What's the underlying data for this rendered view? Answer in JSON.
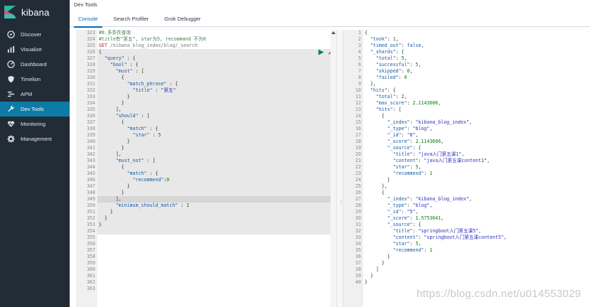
{
  "app": {
    "logo_text": "kibana",
    "title": "Dev Tools"
  },
  "colors": {
    "sidebar_bg": "#222c37",
    "active_nav": "#0e7ba4",
    "tab_accent": "#006bb4"
  },
  "sidebar": {
    "items": [
      {
        "label": "Discover",
        "icon": "compass-icon"
      },
      {
        "label": "Visualize",
        "icon": "bar-chart-icon"
      },
      {
        "label": "Dashboard",
        "icon": "dashboard-icon"
      },
      {
        "label": "Timelion",
        "icon": "shield-icon"
      },
      {
        "label": "APM",
        "icon": "apm-icon"
      },
      {
        "label": "Dev Tools",
        "icon": "wrench-icon",
        "active": true
      },
      {
        "label": "Monitoring",
        "icon": "heartbeat-icon"
      },
      {
        "label": "Management",
        "icon": "gear-icon"
      }
    ]
  },
  "tabs": [
    {
      "label": "Console",
      "active": true
    },
    {
      "label": "Search Profiler"
    },
    {
      "label": "Grok Debugger"
    }
  ],
  "request": {
    "line_start": 323,
    "lines": [
      "#8.多条件查询",
      "#title有\"第五\", star为5, recommand 不为0",
      "GET /kibana_blog_index/blog/_search",
      "{",
      "  \"query\" : {",
      "    \"bool\" : {",
      "      \"must\" : [",
      "        {",
      "          \"match_phrase\" : {",
      "            \"title\" : \"第五\"",
      "          }",
      "        }",
      "      ],",
      "      \"should\" : [",
      "        {",
      "          \"match\" : {",
      "            \"star\" : 5",
      "          }",
      "        }",
      "      ],",
      "      \"must_not\" : [",
      "        {",
      "          \"match\" : {",
      "            \"recommend\":0",
      "          }",
      "        }",
      "      ],",
      "      \"minimum_should_match\" : 1",
      "    }",
      "  }",
      "}",
      "",
      "",
      "",
      "",
      "",
      "",
      "",
      "",
      "",
      ""
    ]
  },
  "response": {
    "line_start": 1,
    "lines": [
      "{",
      "  \"took\": 1,",
      "  \"timed_out\": false,",
      "  \"_shards\": {",
      "    \"total\": 5,",
      "    \"successful\": 5,",
      "    \"skipped\": 0,",
      "    \"failed\": 0",
      "  },",
      "  \"hits\": {",
      "    \"total\": 2,",
      "    \"max_score\": 2.1143606,",
      "    \"hits\": [",
      "      {",
      "        \"_index\": \"kibana_blog_index\",",
      "        \"_type\": \"blog\",",
      "        \"_id\": \"6\",",
      "        \"_score\": 2.1143606,",
      "        \"_source\": {",
      "          \"title\": \"java入门第五课1\",",
      "          \"content\": \"java入门第五课content1\",",
      "          \"star\": 5,",
      "          \"recommend\": 1",
      "        }",
      "      },",
      "      {",
      "        \"_index\": \"kibana_blog_index\",",
      "        \"_type\": \"blog\",",
      "        \"_id\": \"5\",",
      "        \"_score\": 1.5753641,",
      "        \"_source\": {",
      "          \"title\": \"springboot入门第五课5\",",
      "          \"content\": \"springboot入门第五课content5\",",
      "          \"star\": 5,",
      "          \"recommend\": 1",
      "        }",
      "      }",
      "    ]",
      "  }",
      "}"
    ]
  },
  "watermark": "https://blog.csdn.net/u014553029"
}
